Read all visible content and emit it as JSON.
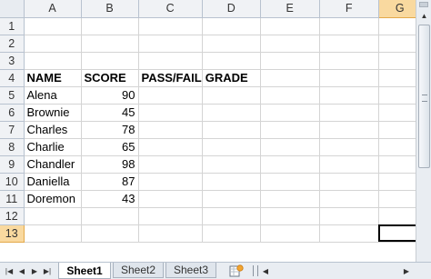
{
  "columns": [
    "A",
    "B",
    "C",
    "D",
    "E",
    "F",
    "G"
  ],
  "rows": [
    "1",
    "2",
    "3",
    "4",
    "5",
    "6",
    "7",
    "8",
    "9",
    "10",
    "11",
    "12",
    "13"
  ],
  "table": {
    "headers": [
      "NAME",
      "SCORE",
      "PASS/FAIL",
      "GRADE"
    ],
    "names": [
      "Alena",
      "Brownie",
      "Charles",
      "Charlie",
      "Chandler",
      "Daniella",
      "Doremon"
    ],
    "scores": [
      "90",
      "45",
      "78",
      "65",
      "98",
      "87",
      "43"
    ]
  },
  "selection": {
    "column": "G",
    "row": "13"
  },
  "sheet_tabs": [
    "Sheet1",
    "Sheet2",
    "Sheet3"
  ],
  "active_sheet": "Sheet1",
  "colors": {
    "selected_header": "#f9d99f",
    "header_bg": "#f0f2f5",
    "gridline": "#d4d4d4"
  },
  "icons": [
    "first-sheet-icon",
    "prev-sheet-icon",
    "next-sheet-icon",
    "last-sheet-icon",
    "insert-sheet-icon",
    "scroll-up-icon",
    "scroll-left-icon",
    "scroll-right-icon"
  ]
}
